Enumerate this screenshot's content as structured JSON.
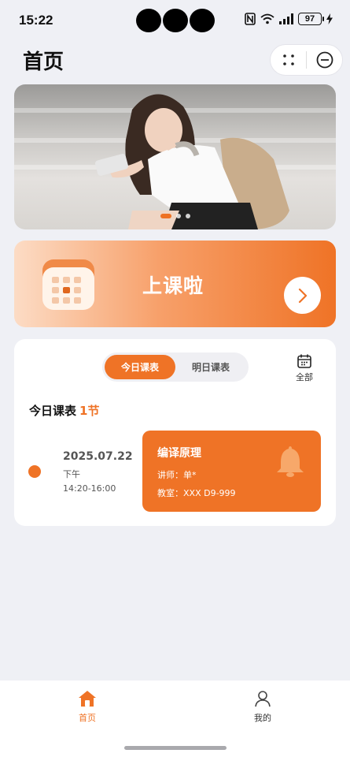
{
  "status_bar": {
    "time": "15:22",
    "battery": "97"
  },
  "header": {
    "title": "首页"
  },
  "banner": {
    "slide_count": 3,
    "active_slide": 1
  },
  "class_card": {
    "title": "上课啦"
  },
  "schedule": {
    "tabs": [
      {
        "label": "今日课表",
        "active": true
      },
      {
        "label": "明日课表",
        "active": false
      }
    ],
    "all_label": "全部",
    "count_label": "今日课表",
    "count_value": "1节",
    "items": [
      {
        "date": "2025.07.22",
        "period": "下午",
        "time_range": "14:20-16:00",
        "course": "编译原理",
        "teacher_line": "讲师：单*",
        "room_line": "教室：XXX D9-999"
      }
    ]
  },
  "nav": {
    "items": [
      {
        "label": "首页",
        "icon": "home-icon",
        "active": true
      },
      {
        "label": "我的",
        "icon": "user-icon",
        "active": false
      }
    ]
  },
  "colors": {
    "accent": "#ef7326",
    "background": "#eff0f5"
  }
}
